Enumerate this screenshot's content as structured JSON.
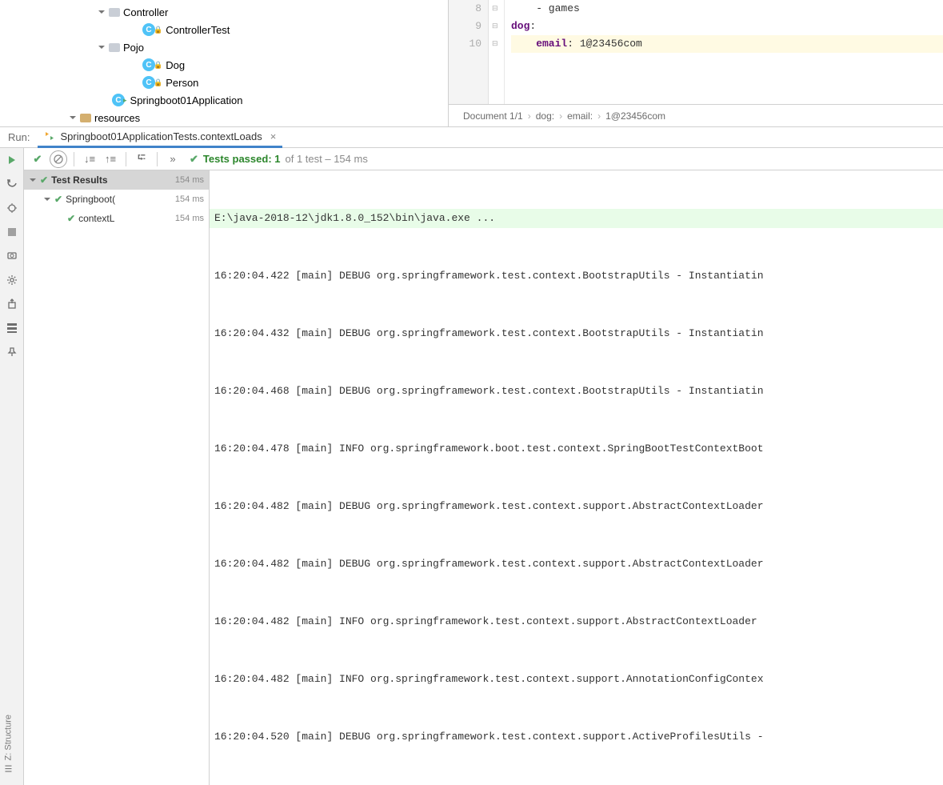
{
  "tree": {
    "controller": "Controller",
    "controllerTest": "ControllerTest",
    "pojo": "Pojo",
    "dog": "Dog",
    "person": "Person",
    "app": "Springboot01Application",
    "resources": "resources"
  },
  "editor": {
    "lines": {
      "n8": "8",
      "n9": "9",
      "n10": "10"
    },
    "l8": "    - games",
    "l9_key": "dog",
    "l10_key": "    email",
    "l10_val": " 1@23456com"
  },
  "breadcrumb": {
    "doc": "Document 1/1",
    "b1": "dog:",
    "b2": "email:",
    "b3": "1@23456com"
  },
  "run": {
    "label": "Run:",
    "tab": "Springboot01ApplicationTests.contextLoads",
    "close": "×"
  },
  "status": {
    "prefix": "Tests passed: 1",
    "suffix": " of 1 test – 154 ms"
  },
  "testTree": {
    "root": "Test Results",
    "rootTime": "154 ms",
    "node1": "Springboot(",
    "node1Time": "154 ms",
    "node2": "contextL",
    "node2Time": "154 ms"
  },
  "console": {
    "cmd": "E:\\java-2018-12\\jdk1.8.0_152\\bin\\java.exe ...",
    "l1": "16:20:04.422 [main] DEBUG org.springframework.test.context.BootstrapUtils - Instantiatin",
    "l2": "16:20:04.432 [main] DEBUG org.springframework.test.context.BootstrapUtils - Instantiatin",
    "l3": "16:20:04.468 [main] DEBUG org.springframework.test.context.BootstrapUtils - Instantiatin",
    "l4": "16:20:04.478 [main] INFO org.springframework.boot.test.context.SpringBootTestContextBoot",
    "l5": "16:20:04.482 [main] DEBUG org.springframework.test.context.support.AbstractContextLoader",
    "l6": "16:20:04.482 [main] DEBUG org.springframework.test.context.support.AbstractContextLoader",
    "l7": "16:20:04.482 [main] INFO org.springframework.test.context.support.AbstractContextLoader ",
    "l8": "16:20:04.482 [main] INFO org.springframework.test.context.support.AnnotationConfigContex",
    "l9": "16:20:04.520 [main] DEBUG org.springframework.test.context.support.ActiveProfilesUtils -"
  },
  "structure": "Z: Structure"
}
